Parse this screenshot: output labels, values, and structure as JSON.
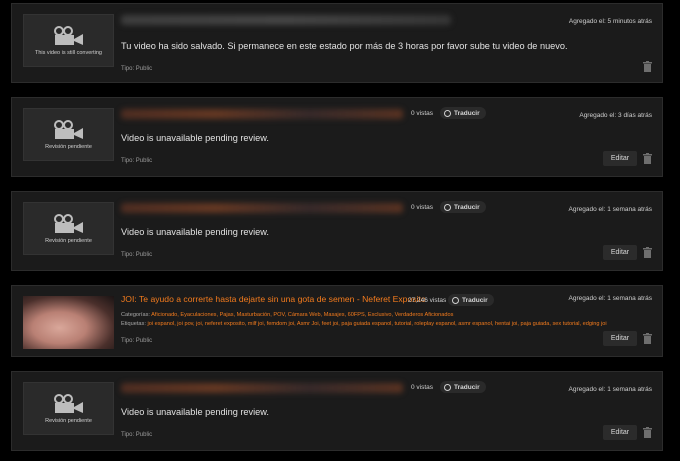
{
  "cards": [
    {
      "thumb_label": "This video is still converting",
      "added": "Agregado el: 5 minutos atrás",
      "message": "Tu video ha sido salvado. Si permanece en este estado por más de 3 horas por favor sube tu video de nuevo.",
      "tipo": "Tipo: Public"
    },
    {
      "thumb_label": "Revisión pendiente",
      "views": "0 vistas",
      "translate": "Traducir",
      "added": "Agregado el: 3 días atrás",
      "message": "Video is unavailable pending review.",
      "tipo": "Tipo: Public",
      "edit": "Editar"
    },
    {
      "thumb_label": "Revisión pendiente",
      "views": "0 vistas",
      "translate": "Traducir",
      "added": "Agregado el: 1 semana atrás",
      "message": "Video is unavailable pending review.",
      "tipo": "Tipo: Public",
      "edit": "Editar"
    },
    {
      "title": "JOI: Te ayudo a correrte hasta dejarte sin una gota de semen - Neferet Exposito",
      "views": "27,246 vistas",
      "translate": "Traducir",
      "added": "Agregado el: 1 semana atrás",
      "categories_label": "Categorías:",
      "categories": "Aficionado, Eyaculaciones, Pajas, Masturbación, POV, Cámara Web, Masajes, 60FPS, Exclusivo, Verdaderos Aficionados",
      "tags_label": "Etiquetas:",
      "tags": "joi espanol, joi pov, joi, neferet exposito, milf joi, femdom joi, Asmr Joi, feet joi, paja guiada espanol, tutorial, roleplay espanol, asmr espanol, hentai joi, paja guiada, sex tutorial, edging joi",
      "tipo": "Tipo: Public",
      "edit": "Editar"
    },
    {
      "thumb_label": "Revisión pendiente",
      "views": "0 vistas",
      "translate": "Traducir",
      "added": "Agregado el: 1 semana atrás",
      "message": "Video is unavailable pending review.",
      "tipo": "Tipo: Public",
      "edit": "Editar"
    }
  ]
}
